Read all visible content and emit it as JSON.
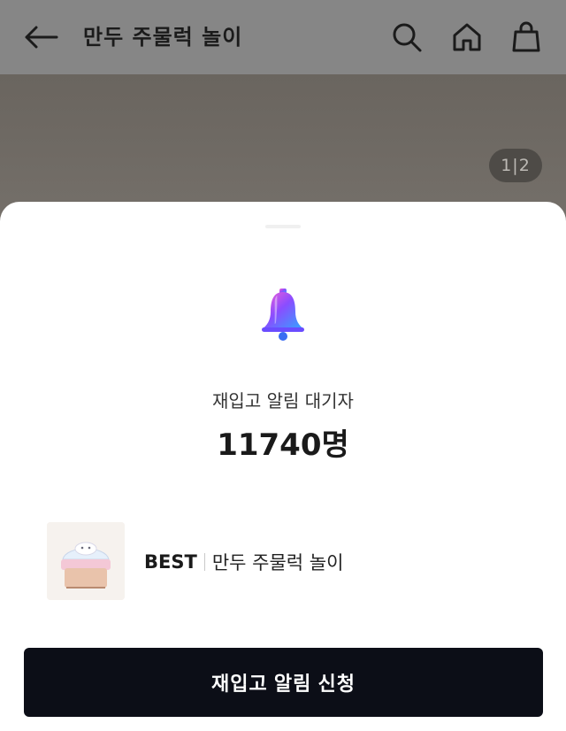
{
  "header": {
    "title": "만두 주물럭 놀이",
    "icons": {
      "back": "arrow-left-icon",
      "search": "search-icon",
      "home": "home-icon",
      "cart": "shopping-bag-icon"
    }
  },
  "gallery": {
    "counter": "1|2"
  },
  "sheet": {
    "bell_icon": "bell-icon",
    "waiting_label": "재입고 알림 대기자",
    "waiting_count": "11740명",
    "product": {
      "badge": "BEST",
      "name": "만두 주물럭 놀이"
    },
    "cta_label": "재입고 알림 신청"
  },
  "colors": {
    "overlay": "#868686",
    "button_bg": "#0c0e17",
    "sheet_bg": "#ffffff"
  }
}
